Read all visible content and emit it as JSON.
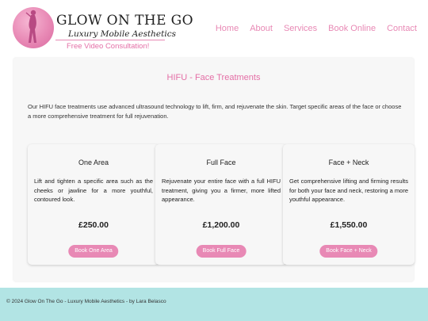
{
  "brand": {
    "title": "GLOW ON THE GO",
    "subtitle": "Luxury Mobile Aesthetics",
    "consultation": "Free Video Consultation!"
  },
  "nav": {
    "items": [
      "Home",
      "About",
      "Services",
      "Book Online",
      "Contact"
    ]
  },
  "section": {
    "title": "HIFU - Face Treatments",
    "description": "Our HIFU face treatments use advanced ultrasound technology to lift, firm, and rejuvenate the skin. Target specific areas of the face or choose a more comprehensive treatment for full rejuvenation."
  },
  "treatments": [
    {
      "name": "One Area",
      "description": "Lift and tighten a specific area such as the cheeks or jawline for a more youthful, contoured look.",
      "price": "£250.00",
      "button": "Book One Area"
    },
    {
      "name": "Full Face",
      "description": "Rejuvenate your entire face with a full HIFU treatment, giving you a firmer, more lifted appearance.",
      "price": "£1,200.00",
      "button": "Book Full Face"
    },
    {
      "name": "Face + Neck",
      "description": "Get comprehensive lifting and firming results for both your face and neck, restoring a more youthful appearance.",
      "price": "£1,550.00",
      "button": "Book Face + Neck"
    }
  ],
  "footer": {
    "text": "© 2024 Glow On The Go - Luxury Mobile Aesthetics - by Lara Belasco"
  },
  "colors": {
    "accent": "#e889b5",
    "footer_bg": "#b2e4e4",
    "panel_bg": "#f7f7f7"
  },
  "icons": {
    "logo": "woman-silhouette-logo"
  }
}
